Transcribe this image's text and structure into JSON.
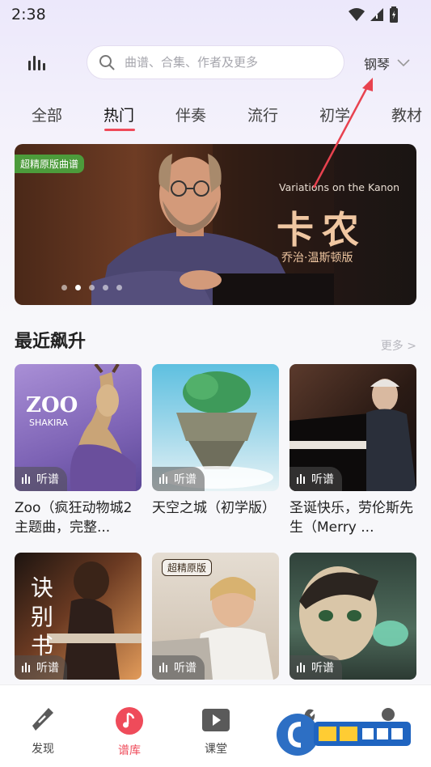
{
  "status_bar": {
    "time": "2:38"
  },
  "search": {
    "placeholder": "曲谱、合集、作者及更多"
  },
  "instrument": {
    "label": "钢琴"
  },
  "tabs": [
    {
      "label": "全部"
    },
    {
      "label": "热门"
    },
    {
      "label": "伴奏"
    },
    {
      "label": "流行"
    },
    {
      "label": "初学"
    },
    {
      "label": "教材"
    }
  ],
  "active_tab": "热门",
  "banner": {
    "tag": "超精原版曲谱",
    "subtitle": "Variations on the Kanon",
    "title": "卡农",
    "byline": "乔治·温斯顿版",
    "slide_count": 5,
    "active_slide": 2
  },
  "section": {
    "title": "最近飙升",
    "more": "更多 >"
  },
  "cards": [
    {
      "title": "Zoo（疯狂动物城2主题曲，完整...",
      "listen": "听谱",
      "cover_text": "ZOO",
      "cover_sub": "SHAKIRA"
    },
    {
      "title": "天空之城（初学版）",
      "listen": "听谱"
    },
    {
      "title": "圣诞快乐，劳伦斯先生（Merry ...",
      "listen": "听谱"
    },
    {
      "title": "",
      "listen": "听谱",
      "cover_text": "诀别书"
    },
    {
      "title": "",
      "listen": "听谱",
      "cover_badge": "超精原版"
    },
    {
      "title": "",
      "listen": "听谱"
    }
  ],
  "bottom_nav": [
    {
      "label": "发现",
      "icon": "discover-icon"
    },
    {
      "label": "谱库",
      "icon": "music-note-icon"
    },
    {
      "label": "课堂",
      "icon": "play-video-icon"
    },
    {
      "label": "",
      "icon": "wrench-icon"
    },
    {
      "label": "",
      "icon": "profile-icon"
    }
  ],
  "colors": {
    "accent": "#ef4b5a",
    "tag_green": "#4c9b3b",
    "banner_title": "#f0c7a2"
  }
}
